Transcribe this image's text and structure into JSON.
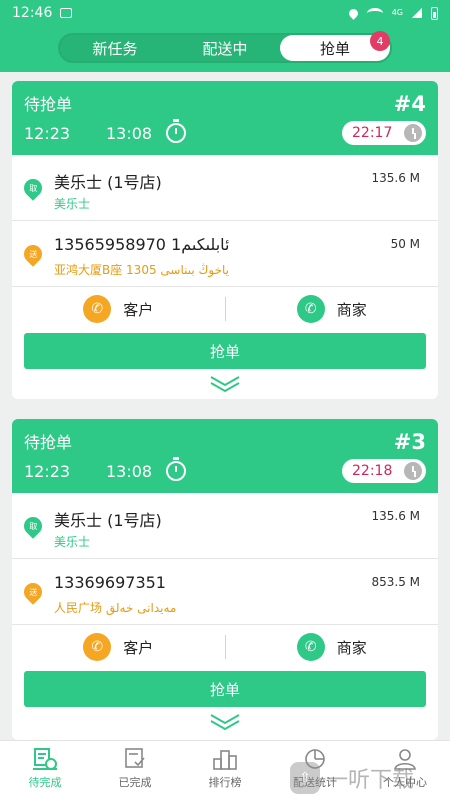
{
  "status_bar": {
    "time": "12:46",
    "network": "4G"
  },
  "tabs": [
    {
      "label": "新任务"
    },
    {
      "label": "配送中"
    },
    {
      "label": "抢单"
    }
  ],
  "tab_badge": "4",
  "orders": [
    {
      "status": "待抢单",
      "number": "#4",
      "time_placed": "12:23",
      "time_elapsed": "13:08",
      "deadline": "22:17",
      "pickup": {
        "badge": "取",
        "name": "美乐士 (1号店)",
        "sub": "美乐士",
        "distance": "135.6 M"
      },
      "dropoff": {
        "badge": "送",
        "name": "13565958970 ئابلىكىم1",
        "sub": "亚鸿大厦B座 1305 ياخوڭ بىناسى",
        "distance": "50 M"
      },
      "contact_customer": "客户",
      "contact_merchant": "商家",
      "grab_button": "抢单"
    },
    {
      "status": "待抢单",
      "number": "#3",
      "time_placed": "12:23",
      "time_elapsed": "13:08",
      "deadline": "22:18",
      "pickup": {
        "badge": "取",
        "name": "美乐士 (1号店)",
        "sub": "美乐士",
        "distance": "135.6 M"
      },
      "dropoff": {
        "badge": "送",
        "name": "13369697351",
        "sub": "人民广场 مەيدانى خەلق",
        "distance": "853.5 M"
      },
      "contact_customer": "客户",
      "contact_merchant": "商家",
      "grab_button": "抢单"
    }
  ],
  "bottom_nav": [
    {
      "label": "待完成",
      "icon": "pending-icon"
    },
    {
      "label": "已完成",
      "icon": "done-icon"
    },
    {
      "label": "排行榜",
      "icon": "ranking-icon"
    },
    {
      "label": "配送统计",
      "icon": "stats-icon"
    },
    {
      "label": "个人中心",
      "icon": "profile-icon"
    }
  ],
  "watermark": {
    "text": "一听下载"
  },
  "colors": {
    "primary": "#2ec987",
    "accent_orange": "#f5a623",
    "badge": "#e23c66",
    "deadline_text": "#d1265c"
  }
}
